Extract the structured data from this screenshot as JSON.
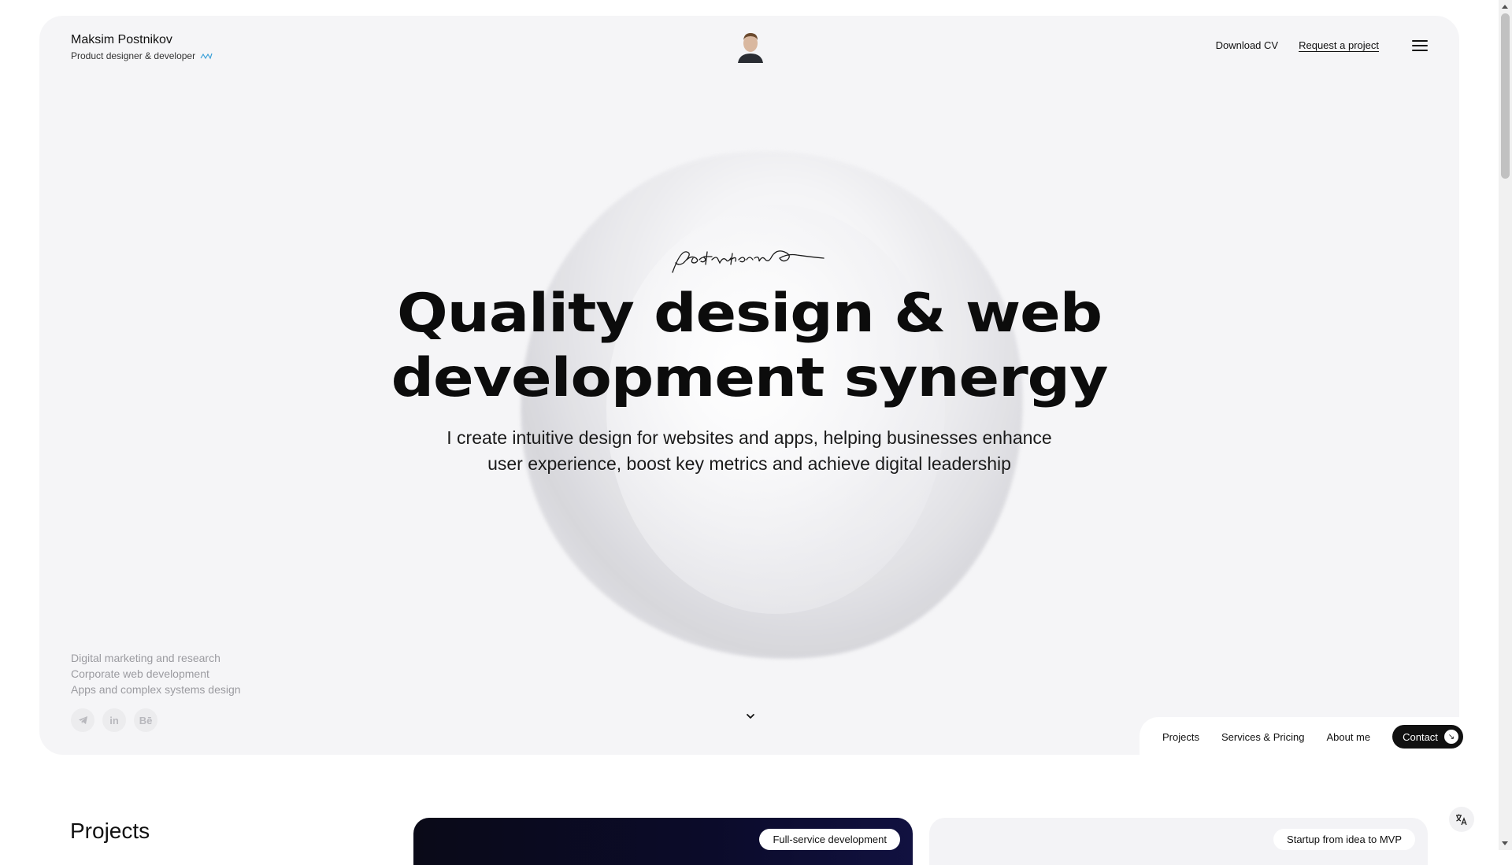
{
  "header": {
    "name": "Maksim Postnikov",
    "subtitle": "Product designer & developer",
    "download_cv": "Download CV",
    "request_project": "Request a project"
  },
  "hero": {
    "headline_line1": "Quality design & web",
    "headline_line2": "development synergy",
    "subline_line1": "I create intuitive design for websites and apps, helping businesses enhance",
    "subline_line2": "user experience, boost key metrics and achieve digital leadership"
  },
  "services": [
    "Digital marketing and research",
    "Corporate web development",
    "Apps and complex systems design"
  ],
  "socials": {
    "telegram": "telegram-icon",
    "linkedin": "in",
    "behance": "Bē"
  },
  "bottom_nav": {
    "projects": "Projects",
    "services_pricing": "Services & Pricing",
    "about": "About me",
    "contact": "Contact"
  },
  "projects": {
    "title": "Projects",
    "cards": [
      {
        "tag": "Full-service development"
      },
      {
        "tag": "Startup from idea to MVP"
      }
    ]
  },
  "colors": {
    "hero_bg": "#f5f5f7",
    "accent_dark": "#111111",
    "muted_text": "#9b9ba0",
    "brand_wave": "#3aa0d8"
  }
}
